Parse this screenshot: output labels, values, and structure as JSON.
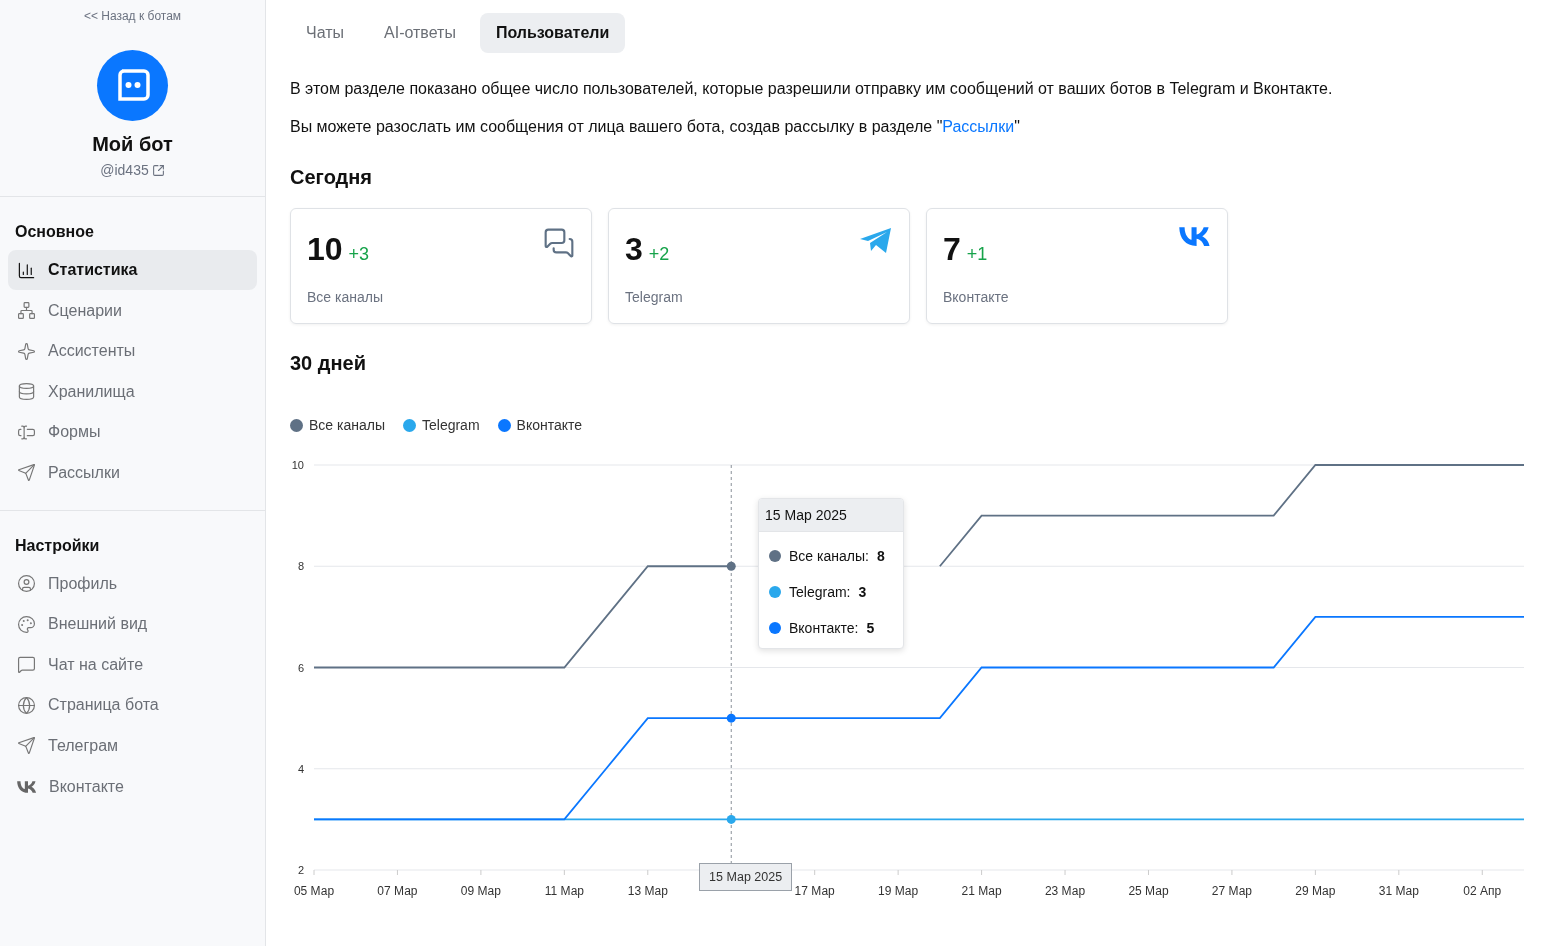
{
  "sidebar": {
    "back_link": "<< Назад к ботам",
    "bot": {
      "name": "Мой бот",
      "handle": "@id435"
    },
    "sections": [
      {
        "title": "Основное",
        "items": [
          {
            "label": "Статистика",
            "selected": true
          },
          {
            "label": "Сценарии",
            "selected": false
          },
          {
            "label": "Ассистенты",
            "selected": false
          },
          {
            "label": "Хранилища",
            "selected": false
          },
          {
            "label": "Формы",
            "selected": false
          },
          {
            "label": "Рассылки",
            "selected": false
          }
        ]
      },
      {
        "title": "Настройки",
        "items": [
          {
            "label": "Профиль",
            "selected": false
          },
          {
            "label": "Внешний вид",
            "selected": false
          },
          {
            "label": "Чат на сайте",
            "selected": false
          },
          {
            "label": "Страница бота",
            "selected": false
          },
          {
            "label": "Телеграм",
            "selected": false
          },
          {
            "label": "Вконтакте",
            "selected": false
          }
        ]
      }
    ]
  },
  "tabs": [
    {
      "label": "Чаты",
      "selected": false
    },
    {
      "label": "AI-ответы",
      "selected": false
    },
    {
      "label": "Пользователи",
      "selected": true
    }
  ],
  "intro": "В этом разделе показано общее число пользователей, которые разрешили отправку им сообщений от ваших ботов в Telegram и Вконтакте.",
  "note": {
    "text": "Вы можете разослать им сообщения от лица вашего бота, создав рассылку в разделе \"",
    "link": "Рассылки",
    "after": "\""
  },
  "today": {
    "title": "Сегодня",
    "cards": [
      {
        "kind": "all",
        "value": "10",
        "delta": "+3",
        "label": "Все каналы"
      },
      {
        "kind": "telegram",
        "value": "3",
        "delta": "+2",
        "label": "Telegram"
      },
      {
        "kind": "vk",
        "value": "7",
        "delta": "+1",
        "label": "Вконтакте"
      }
    ]
  },
  "period": {
    "title": "30 дней",
    "chart_data": {
      "type": "line",
      "categories": [
        "05 Мар",
        null,
        "07 Мар",
        null,
        "09 Мар",
        null,
        "11 Мар",
        null,
        "13 Мар",
        null,
        null,
        null,
        "17 Мар",
        null,
        "19 Мар",
        null,
        "21 Мар",
        null,
        "23 Мар",
        null,
        "25 Мар",
        null,
        "27 Мар",
        null,
        "29 Мар",
        null,
        "31 Мар",
        null,
        "02 Апр",
        null
      ],
      "grid": true,
      "series": [
        {
          "name": "Все каналы",
          "color": "#5f7185",
          "values": [
            6,
            6,
            6,
            6,
            6,
            6,
            6,
            7,
            8,
            8,
            8,
            null,
            null,
            null,
            null,
            8,
            9,
            9,
            9,
            9,
            9,
            9,
            9,
            9,
            10,
            10,
            10,
            10,
            10,
            10
          ]
        },
        {
          "name": "Telegram",
          "color": "#2aa8ec",
          "values": [
            3,
            3,
            3,
            3,
            3,
            3,
            3,
            3,
            3,
            3,
            3,
            3,
            3,
            3,
            3,
            3,
            3,
            3,
            3,
            3,
            3,
            3,
            3,
            3,
            3,
            3,
            3,
            3,
            3,
            3
          ]
        },
        {
          "name": "Вконтакте",
          "color": "#0a77ff",
          "values": [
            3,
            3,
            3,
            3,
            3,
            3,
            3,
            4,
            5,
            5,
            5,
            5,
            5,
            5,
            5,
            5,
            6,
            6,
            6,
            6,
            6,
            6,
            6,
            6,
            7,
            7,
            7,
            7,
            7,
            7
          ]
        }
      ],
      "ylim": [
        2,
        10
      ],
      "yticks": [
        2,
        4,
        6,
        8,
        10
      ]
    },
    "tooltip": {
      "date": "15 Мар 2025",
      "axis_label": "15 Мар 2025",
      "rows": [
        {
          "label": "Все каналы:",
          "value": "8"
        },
        {
          "label": "Telegram:",
          "value": "3"
        },
        {
          "label": "Вконтакте:",
          "value": "5"
        }
      ]
    }
  }
}
